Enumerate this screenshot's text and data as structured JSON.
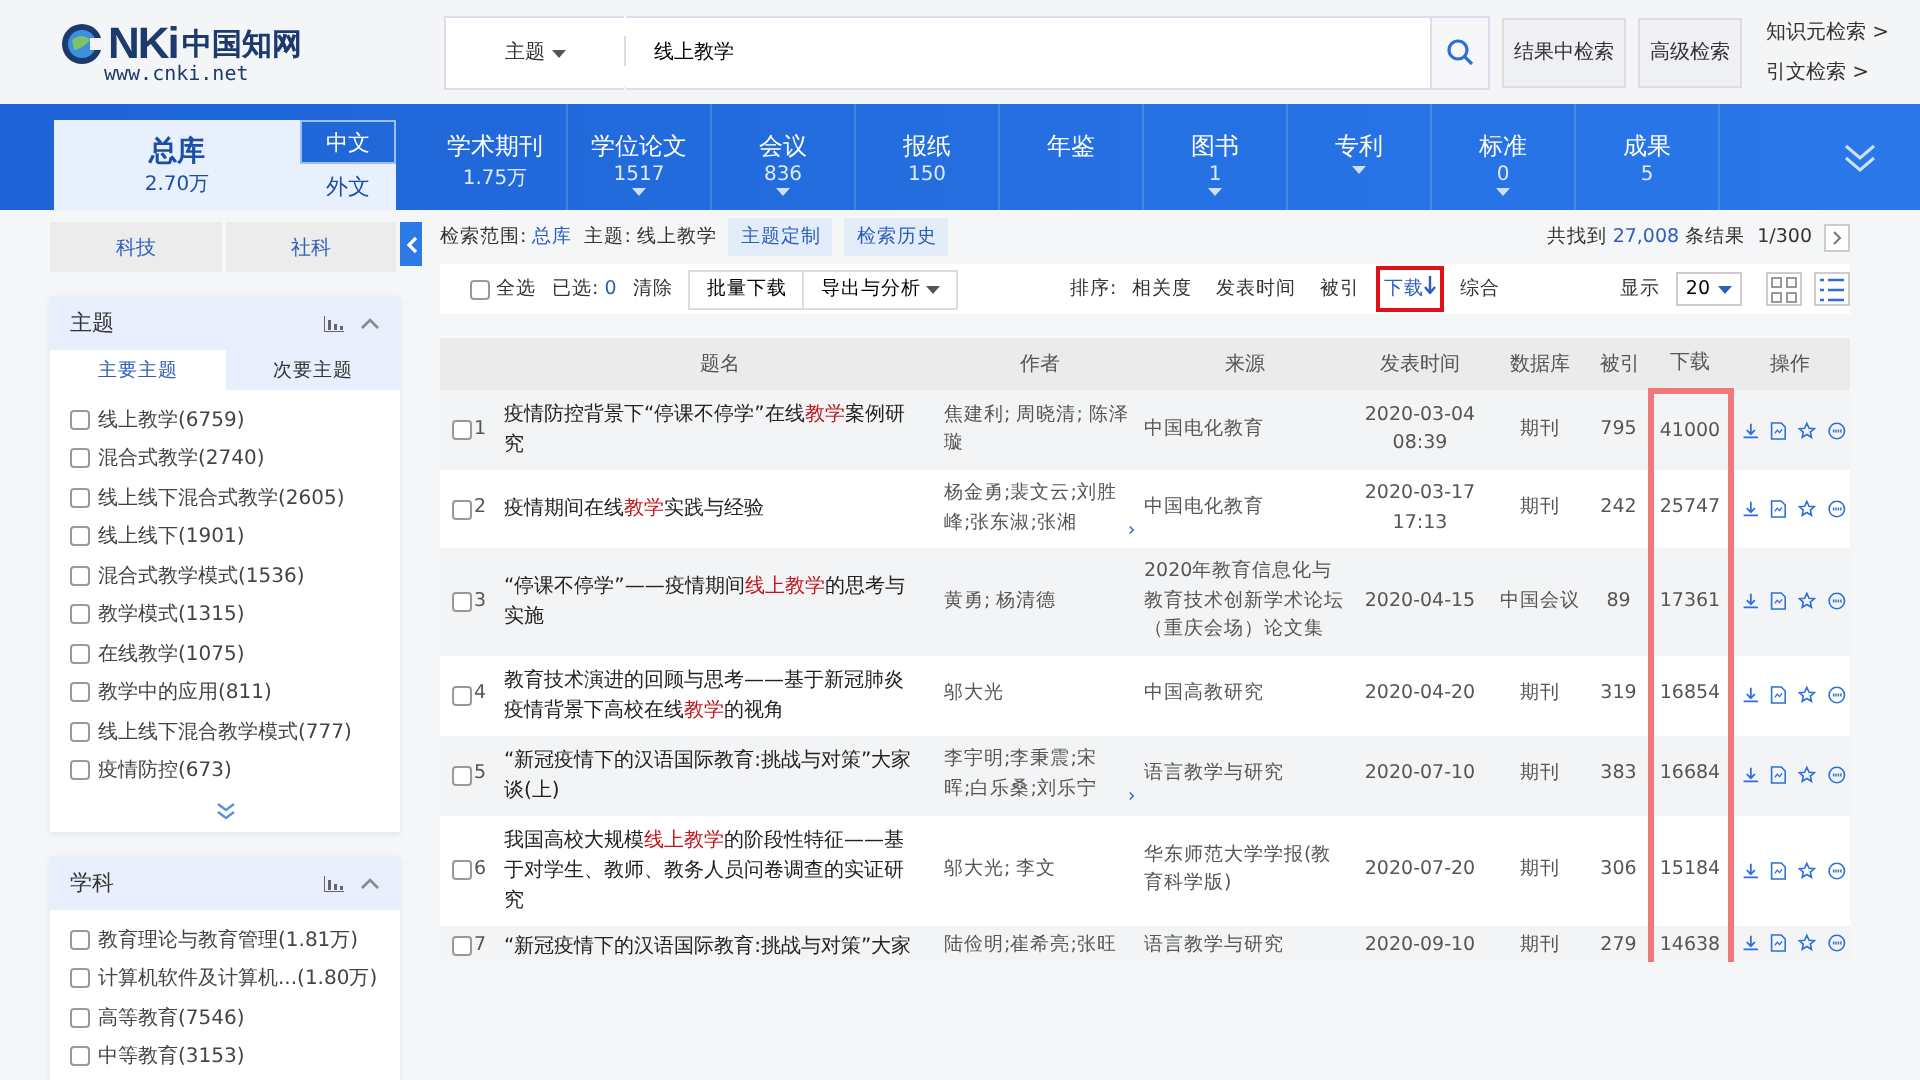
{
  "logo": {
    "mark": "NKi",
    "name": "中国知网",
    "url": "www.cnki.net"
  },
  "search": {
    "field": "主题",
    "value": "线上教学",
    "buttons": [
      "结果中检索",
      "高级检索"
    ],
    "links": [
      "知识元检索 >",
      "引文检索 >"
    ]
  },
  "nav": {
    "total": {
      "label": "总库",
      "count": "2.70万"
    },
    "lang_tabs": [
      {
        "label": "中文",
        "selected": false
      },
      {
        "label": "外文",
        "selected": true
      }
    ],
    "categories": [
      {
        "label": "学术期刊",
        "count": "1.75万",
        "dropdown": false
      },
      {
        "label": "学位论文",
        "count": "1517",
        "dropdown": true
      },
      {
        "label": "会议",
        "count": "836",
        "dropdown": true
      },
      {
        "label": "报纸",
        "count": "150",
        "dropdown": false
      },
      {
        "label": "年鉴",
        "dropdown": false
      },
      {
        "label": "图书",
        "count": "1",
        "dropdown": true
      },
      {
        "label": "专利",
        "dropdown": true
      },
      {
        "label": "标准",
        "count": "0",
        "dropdown": true
      },
      {
        "label": "成果",
        "count": "5",
        "dropdown": false
      }
    ]
  },
  "sidebar": {
    "tabs": [
      {
        "label": "科技",
        "selected": false
      },
      {
        "label": "社科",
        "selected": false
      }
    ],
    "panels": [
      {
        "title": "主题",
        "subtabs": [
          {
            "label": "主要主题",
            "selected": true
          },
          {
            "label": "次要主题",
            "selected": false
          }
        ],
        "more": true,
        "items": [
          {
            "label": "线上教学",
            "count": "(6759)",
            "checked": false
          },
          {
            "label": "混合式教学",
            "count": "(2740)",
            "checked": false
          },
          {
            "label": "线上线下混合式教学",
            "count": "(2605)",
            "checked": false
          },
          {
            "label": "线上线下",
            "count": "(1901)",
            "checked": false
          },
          {
            "label": "混合式教学模式",
            "count": "(1536)",
            "checked": false
          },
          {
            "label": "教学模式",
            "count": "(1315)",
            "checked": false
          },
          {
            "label": "在线教学",
            "count": "(1075)",
            "checked": false
          },
          {
            "label": "教学中的应用",
            "count": "(811)",
            "checked": false
          },
          {
            "label": "线上线下混合教学模式",
            "count": "(777)",
            "checked": false
          },
          {
            "label": "疫情防控",
            "count": "(673)",
            "checked": false
          }
        ]
      },
      {
        "title": "学科",
        "more": false,
        "items": [
          {
            "label": "教育理论与教育管理",
            "count": "(1.81万)",
            "checked": false
          },
          {
            "label": "计算机软件及计算机...",
            "count": "(1.80万)",
            "checked": false
          },
          {
            "label": "高等教育",
            "count": "(7546)",
            "checked": false
          },
          {
            "label": "中等教育",
            "count": "(3153)",
            "checked": false
          }
        ]
      }
    ]
  },
  "results": {
    "scope_label": "检索范围:",
    "scope": "总库",
    "query": "主题: 线上教学",
    "buttons": [
      "主题定制",
      "检索历史"
    ],
    "found_prefix": "共找到",
    "found": "27,008",
    "found_suffix": "条结果",
    "page": "1/300"
  },
  "toolbar": {
    "select_all": {
      "label": "全选",
      "checked": false
    },
    "selected_label": "已选:",
    "selected_count": "0",
    "clear": "清除",
    "batch": "批量下载",
    "export": "导出与分析",
    "sort_label": "排序:",
    "sorts": [
      {
        "label": "相关度",
        "selected": false,
        "highlighted": false
      },
      {
        "label": "发表时间",
        "selected": false,
        "highlighted": false
      },
      {
        "label": "被引",
        "selected": false,
        "highlighted": false
      },
      {
        "label": "下载",
        "selected": true,
        "highlighted": true
      },
      {
        "label": "综合",
        "selected": false,
        "highlighted": false
      }
    ],
    "page_size_label": "显示",
    "page_size": "20",
    "views": [
      {
        "kind": "grid",
        "selected": false
      },
      {
        "kind": "list",
        "selected": true
      }
    ]
  },
  "table": {
    "columns": [
      {
        "label": "题名",
        "highlighted": false
      },
      {
        "label": "作者",
        "highlighted": false
      },
      {
        "label": "来源",
        "highlighted": false
      },
      {
        "label": "发表时间",
        "highlighted": false
      },
      {
        "label": "数据库",
        "highlighted": false
      },
      {
        "label": "被引",
        "highlighted": false
      },
      {
        "label": "下载",
        "highlighted": true
      },
      {
        "label": "操作",
        "highlighted": false
      }
    ],
    "rows": [
      {
        "index": "1",
        "checked": false,
        "title": [
          {
            "text": "疫情防控背景下“停课不停学”在线",
            "hl": false
          },
          {
            "text": "教学",
            "hl": true
          },
          {
            "text": "案例研究",
            "hl": false
          }
        ],
        "authors": "焦建利; 周晓清; 陈泽璇",
        "authors_more": false,
        "source": "中国电化教育",
        "date": "2020-03-04",
        "time": "08:39",
        "database": "期刊",
        "cited": "795",
        "downloads": "41000"
      },
      {
        "index": "2",
        "checked": false,
        "title": [
          {
            "text": "疫情期间在线",
            "hl": false
          },
          {
            "text": "教学",
            "hl": true
          },
          {
            "text": "实践与经验",
            "hl": false
          }
        ],
        "authors": "杨金勇;裴文云;刘胜峰;张东淑;张湘",
        "authors_more": true,
        "source": "中国电化教育",
        "date": "2020-03-17",
        "time": "17:13",
        "database": "期刊",
        "cited": "242",
        "downloads": "25747"
      },
      {
        "index": "3",
        "checked": false,
        "title": [
          {
            "text": "“停课不停学”——疫情期间",
            "hl": false
          },
          {
            "text": "线上教学",
            "hl": true
          },
          {
            "text": "的思考与实施",
            "hl": false
          }
        ],
        "authors": "黄勇; 杨清德",
        "authors_more": false,
        "source": "2020年教育信息化与教育技术创新学术论坛（重庆会场）论文集",
        "date": "2020-04-15",
        "database": "中国会议",
        "cited": "89",
        "downloads": "17361"
      },
      {
        "index": "4",
        "checked": false,
        "title": [
          {
            "text": "教育技术演进的回顾与思考——基于新冠肺炎疫情背景下高校在线",
            "hl": false
          },
          {
            "text": "教学",
            "hl": true
          },
          {
            "text": "的视角",
            "hl": false
          }
        ],
        "authors": "邬大光",
        "authors_more": false,
        "source": "中国高教研究",
        "date": "2020-04-20",
        "database": "期刊",
        "cited": "319",
        "downloads": "16854"
      },
      {
        "index": "5",
        "checked": false,
        "title": [
          {
            "text": "“新冠疫情下的汉语国际教育:挑战与对策”大家谈(上)",
            "hl": false
          }
        ],
        "authors": "李宇明;李秉震;宋晖;白乐桑;刘乐宁",
        "authors_more": true,
        "source": "语言教学与研究",
        "date": "2020-07-10",
        "database": "期刊",
        "cited": "383",
        "downloads": "16684"
      },
      {
        "index": "6",
        "checked": false,
        "title": [
          {
            "text": "我国高校大规模",
            "hl": false
          },
          {
            "text": "线上教学",
            "hl": true
          },
          {
            "text": "的阶段性特征——基于对学生、教师、教务人员问卷调查的实证研究",
            "hl": false
          }
        ],
        "authors": "邬大光; 李文",
        "authors_more": false,
        "source": "华东师范大学学报(教育科学版)",
        "date": "2020-07-20",
        "database": "期刊",
        "cited": "306",
        "downloads": "15184"
      },
      {
        "index": "7",
        "checked": false,
        "title": [
          {
            "text": "“新冠疫情下的汉语国际教育:挑战与对策”大家",
            "hl": false
          }
        ],
        "authors": "陆俭明;崔希亮;张旺",
        "authors_more": false,
        "source": "语言教学与研究",
        "date": "2020-09-10",
        "database": "期刊",
        "cited": "279",
        "downloads": "14638"
      }
    ]
  }
}
